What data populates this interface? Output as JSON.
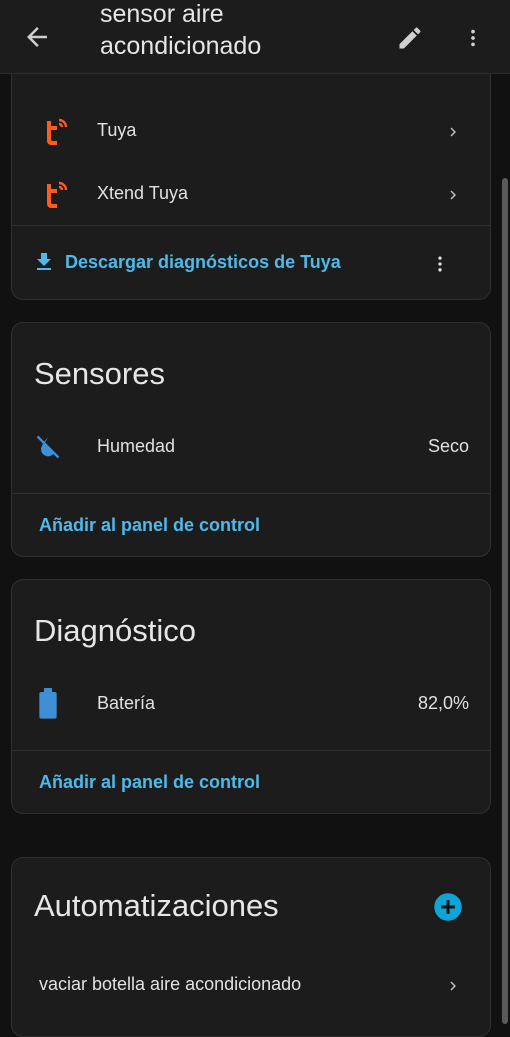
{
  "header": {
    "title": "sensor aire acondicionado"
  },
  "integrations": {
    "items": [
      {
        "label": "Tuya"
      },
      {
        "label": "Xtend Tuya"
      }
    ],
    "download_label": "Descargar diagnósticos de Tuya"
  },
  "sensors": {
    "title": "Sensores",
    "entity_label": "Humedad",
    "entity_value": "Seco",
    "add_label": "Añadir al panel de control"
  },
  "diagnostics": {
    "title": "Diagnóstico",
    "entity_label": "Batería",
    "entity_value": "82,0%",
    "add_label": "Añadir al panel de control"
  },
  "automations": {
    "title": "Automatizaciones",
    "item_label": "vaciar botella aire acondicionado"
  },
  "colors": {
    "accent": "#4fb9ea",
    "tuya_brand": "#ff5a1f",
    "icon_blue": "#3f8fd6",
    "add_button": "#0ea5d8"
  },
  "icons": [
    "arrow-left-icon",
    "pencil-icon",
    "dots-vertical-icon",
    "tuya-logo-icon",
    "download-icon",
    "water-off-icon",
    "battery-icon",
    "plus-circle-icon",
    "chevron-right-icon"
  ]
}
